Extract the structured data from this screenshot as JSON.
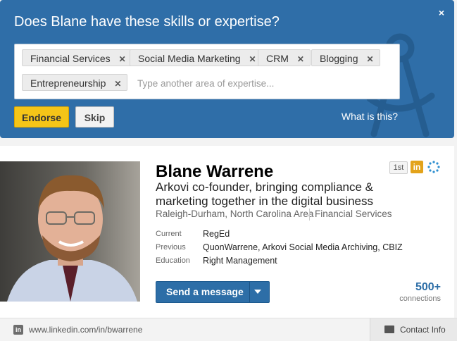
{
  "endorse": {
    "title": "Does Blane have these skills or expertise?",
    "close_label": "×",
    "tags": [
      {
        "label": "Financial Services",
        "remove": "✕"
      },
      {
        "label": "Social Media Marketing",
        "remove": "✕"
      },
      {
        "label": "CRM",
        "remove": "✕"
      },
      {
        "label": "Blogging",
        "remove": "✕"
      },
      {
        "label": "Entrepreneurship",
        "remove": "✕"
      }
    ],
    "input_placeholder": "Type another area of expertise...",
    "endorse_label": "Endorse",
    "skip_label": "Skip",
    "what_is_this": "What is this?",
    "background_color": "#2f6ea8",
    "endorse_button_color": "#f5c518"
  },
  "profile": {
    "name": "Blane Warrene",
    "headline": "Arkovi co-founder, bringing compliance & marketing together in the digital business",
    "location": "Raleigh-Durham, North Carolina Area",
    "industry": "Financial Services",
    "degree_badge": "1st",
    "in_badge": "in",
    "details": [
      {
        "label": "Current",
        "value": "RegEd"
      },
      {
        "label": "Previous",
        "value": "QuonWarrene, Arkovi Social Media Archiving, CBIZ"
      },
      {
        "label": "Education",
        "value": "Right Management"
      }
    ],
    "send_message_label": "Send a message",
    "connections_count": "500+",
    "connections_label": "connections",
    "accent_color": "#2d6ea7",
    "icons": [
      "linkedin-icon",
      "connection-degree-icon",
      "dots-ring-icon",
      "caret-down-icon"
    ]
  },
  "footer": {
    "url_icon": "in",
    "url": "www.linkedin.com/in/bwarrene",
    "contact_label": "Contact Info",
    "icons": [
      "linkedin-icon",
      "contact-card-icon"
    ]
  }
}
